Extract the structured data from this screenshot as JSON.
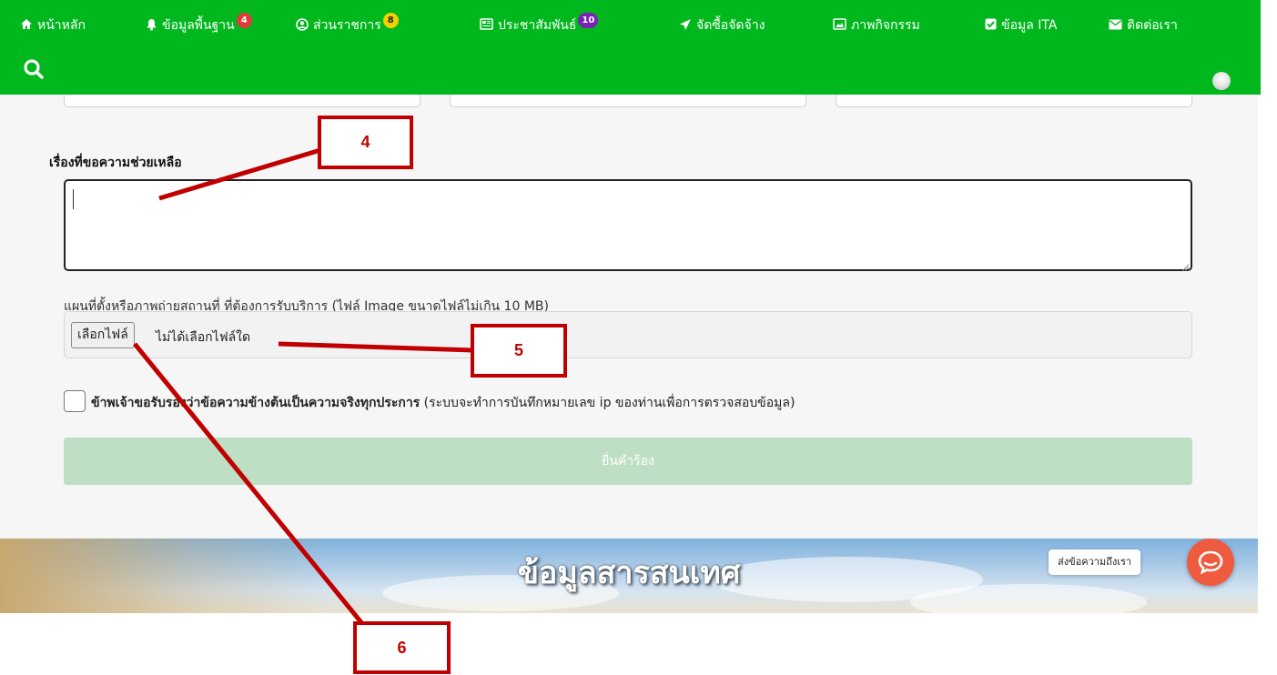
{
  "nav": {
    "items": [
      {
        "label": "หน้าหลัก",
        "icon": "home-icon"
      },
      {
        "label": "ข้อมูลพื้นฐาน",
        "icon": "bell-icon",
        "badge": "4",
        "badge_color": "#e23a3a"
      },
      {
        "label": "ส่วนราชการ",
        "icon": "user-circle-icon",
        "badge": "8",
        "badge_color": "#f5d000"
      },
      {
        "label": "ประชาสัมพันธ์",
        "icon": "newspaper-icon",
        "badge": "10",
        "badge_color": "#7b22b5"
      },
      {
        "label": "จัดซื้อจัดจ้าง",
        "icon": "send-icon"
      },
      {
        "label": "ภาพกิจกรรม",
        "icon": "image-icon"
      },
      {
        "label": "ข้อมูล ITA",
        "icon": "check-square-icon"
      },
      {
        "label": "ติดต่อเรา",
        "icon": "envelope-icon"
      }
    ],
    "search_icon": "search-icon",
    "brand_color": "#00b81d"
  },
  "form": {
    "help_label": "เรื่องที่ขอความช่วยเหลือ",
    "help_value": "",
    "file_label": "แผนที่ตั้งหรือภาพถ่ายสถานที่ ที่ต้องการรับบริการ (ไฟล์ Image ขนาดไฟล์ไม่เกิน 10 MB)",
    "file_button": "เลือกไฟล์",
    "file_status": "ไม่ได้เลือกไฟล์ใด",
    "consent_bold": "ข้าพเจ้าขอรับรองว่าข้อความข้างต้นเป็นความจริงทุกประการ",
    "consent_note": "(ระบบจะทำการบันทึกหมายเลข ip ของท่านเพื่อการตรวจสอบข้อมูล)",
    "consent_checked": false,
    "submit_label": "ยื่นคำร้อง",
    "submit_color": "#bfdfc4"
  },
  "banner": {
    "title": "ข้อมูลสารสนเทศ"
  },
  "chat": {
    "label": "ส่งข้อความถึงเรา",
    "color": "#ef5b3f"
  },
  "annotations": {
    "callout_4": "4",
    "callout_5": "5",
    "callout_6": "6",
    "color": "#c00000"
  }
}
